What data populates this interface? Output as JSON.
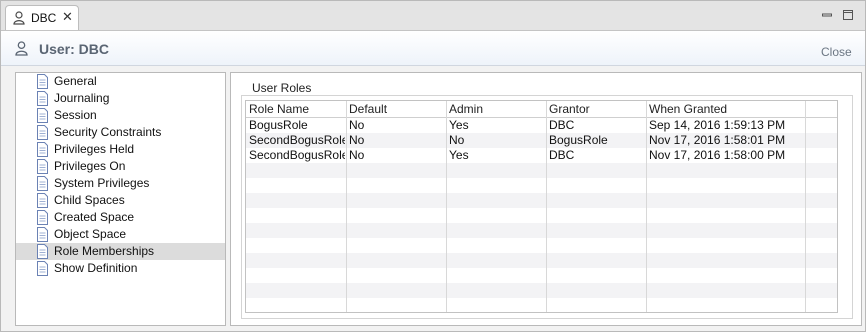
{
  "tab": {
    "label": "DBC"
  },
  "header": {
    "title": "User: DBC",
    "close_label": "Close"
  },
  "nav": {
    "items": [
      {
        "label": "General"
      },
      {
        "label": "Journaling"
      },
      {
        "label": "Session"
      },
      {
        "label": "Security Constraints"
      },
      {
        "label": "Privileges Held"
      },
      {
        "label": "Privileges On"
      },
      {
        "label": "System Privileges"
      },
      {
        "label": "Child Spaces"
      },
      {
        "label": "Created Space"
      },
      {
        "label": "Object Space"
      },
      {
        "label": "Role Memberships",
        "selected": true
      },
      {
        "label": "Show Definition"
      }
    ]
  },
  "roles": {
    "title": "User Roles",
    "columns": [
      "Role Name",
      "Default",
      "Admin",
      "Grantor",
      "When Granted"
    ],
    "rows": [
      [
        "BogusRole",
        "No",
        "Yes",
        "DBC",
        "Sep 14, 2016 1:59:13 PM"
      ],
      [
        "SecondBogusRole",
        "No",
        "No",
        "BogusRole",
        "Nov 17, 2016 1:58:01 PM"
      ],
      [
        "SecondBogusRole",
        "No",
        "Yes",
        "DBC",
        "Nov 17, 2016 1:58:00 PM"
      ]
    ]
  },
  "colors": {
    "selected_bg": "#dcdcdc",
    "header_title": "#5a6573",
    "alt_row": "#f3f3f5"
  }
}
